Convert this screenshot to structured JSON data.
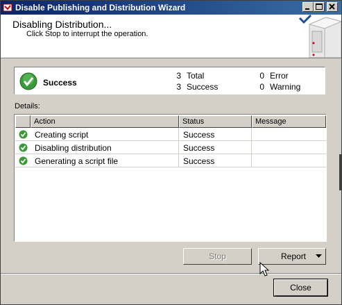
{
  "window": {
    "title": "Disable Publishing and Distribution Wizard"
  },
  "header": {
    "title": "Disabling Distribution...",
    "subtitle": "Click Stop to interrupt the operation."
  },
  "summary": {
    "status": "Success",
    "total_count": "3",
    "total_label": "Total",
    "success_count": "3",
    "success_label": "Success",
    "error_count": "0",
    "error_label": "Error",
    "warning_count": "0",
    "warning_label": "Warning"
  },
  "details": {
    "label": "Details:",
    "columns": [
      "Action",
      "Status",
      "Message"
    ],
    "rows": [
      {
        "action": "Creating script",
        "status": "Success",
        "message": ""
      },
      {
        "action": "Disabling distribution",
        "status": "Success",
        "message": ""
      },
      {
        "action": "Generating a script file",
        "status": "Success",
        "message": ""
      }
    ]
  },
  "buttons": {
    "stop": "Stop",
    "report": "Report",
    "close": "Close"
  },
  "colors": {
    "titlebar": "#0a246a",
    "success_green": "#3a9a3a"
  },
  "icons": [
    "wizard-icon",
    "minimize-icon",
    "maximize-icon",
    "close-icon",
    "server-icon",
    "success-icon",
    "dropdown-arrow-icon",
    "mouse-cursor-icon"
  ]
}
